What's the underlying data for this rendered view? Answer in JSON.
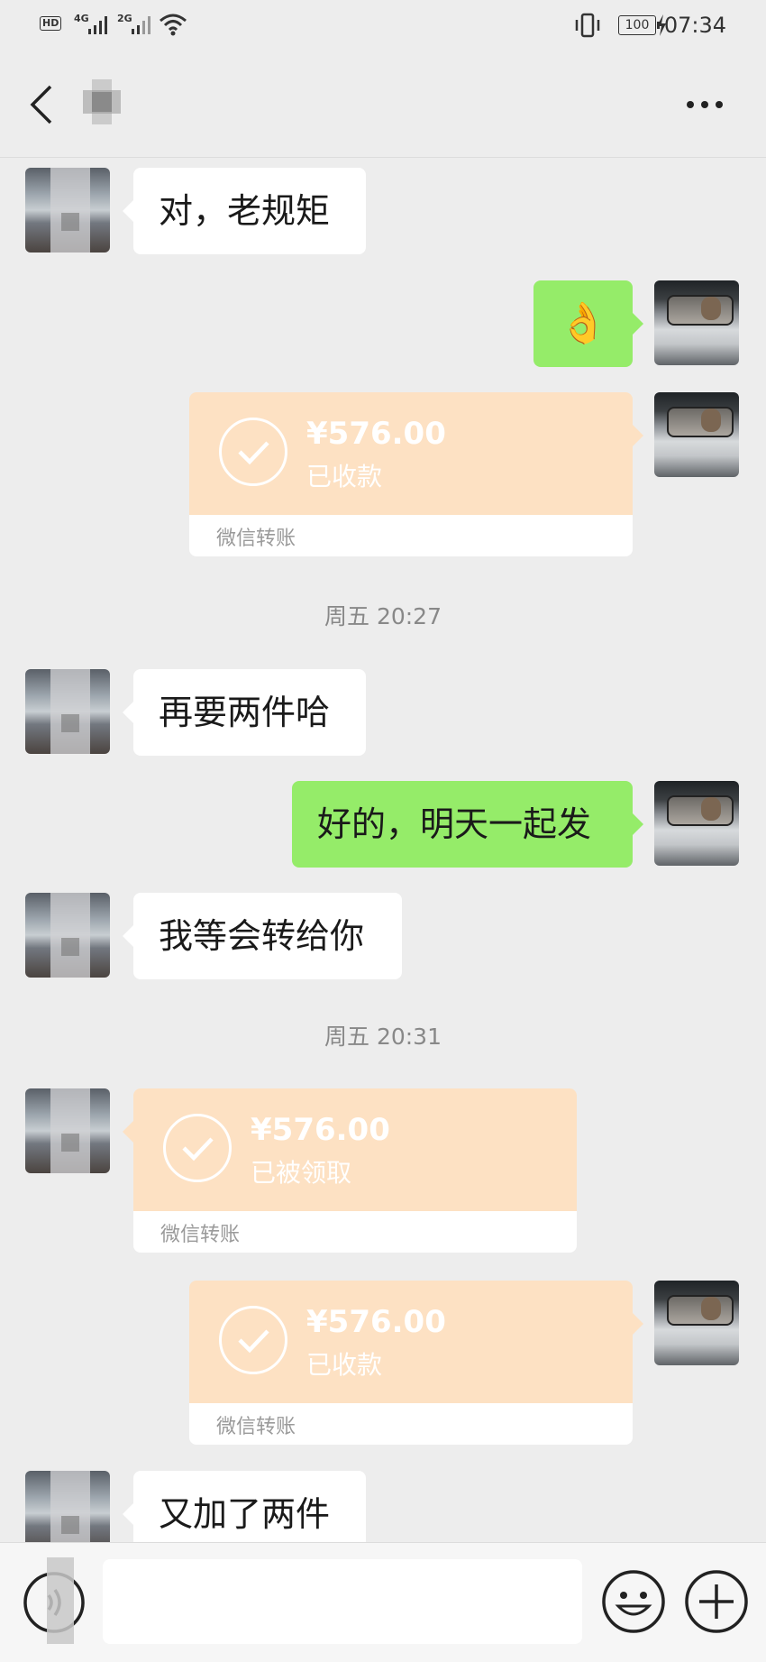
{
  "status_bar": {
    "hd": "HD",
    "net1": "4G",
    "net2": "2G",
    "battery": "100",
    "time": "07:34",
    "icons": [
      "hd-icon",
      "signal-icon",
      "wifi-icon",
      "vibrate-icon",
      "battery-icon",
      "charging-icon"
    ]
  },
  "nav": {
    "back_icon": "chevron-left-icon",
    "more_icon": "more-dots-icon"
  },
  "messages": [
    {
      "side": "left",
      "type": "text",
      "text": "对，老规矩"
    },
    {
      "side": "right",
      "type": "emoji",
      "emoji": "👌"
    },
    {
      "side": "right",
      "type": "transfer",
      "amount": "¥576.00",
      "status": "已收款",
      "label": "微信转账"
    },
    {
      "type": "timestamp",
      "text": "周五 20:27"
    },
    {
      "side": "left",
      "type": "text",
      "text": "再要两件哈"
    },
    {
      "side": "right",
      "type": "text",
      "text": "好的，明天一起发"
    },
    {
      "side": "left",
      "type": "text",
      "text": "我等会转给你"
    },
    {
      "type": "timestamp",
      "text": "周五 20:31"
    },
    {
      "side": "left",
      "type": "transfer",
      "amount": "¥576.00",
      "status": "已被领取",
      "label": "微信转账"
    },
    {
      "side": "right",
      "type": "transfer",
      "amount": "¥576.00",
      "status": "已收款",
      "label": "微信转账"
    },
    {
      "side": "left",
      "type": "text",
      "text": "又加了两件"
    }
  ],
  "input_bar": {
    "value": "",
    "icons": [
      "voice-icon",
      "emoji-icon",
      "plus-icon"
    ]
  },
  "colors": {
    "background": "#ededed",
    "green_bubble": "#95ec69",
    "white_bubble": "#ffffff",
    "transfer_card": "#fde1c3"
  }
}
